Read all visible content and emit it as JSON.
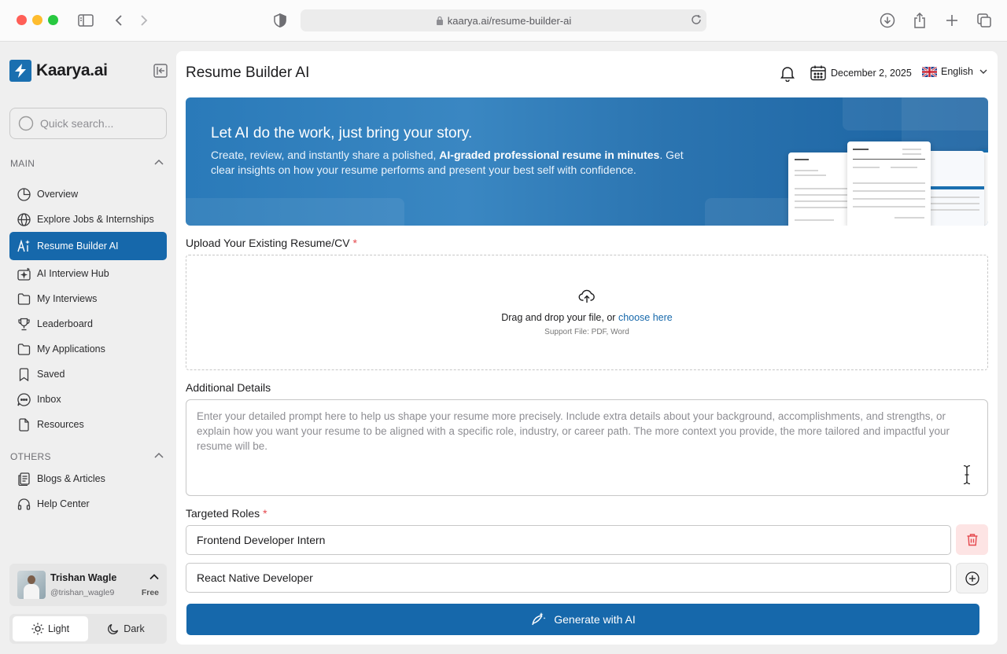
{
  "browser": {
    "url": "kaarya.ai/resume-builder-ai"
  },
  "brand": {
    "name": "Kaarya.ai",
    "accent": "#1668ab"
  },
  "sidebar": {
    "search_placeholder": "Quick search...",
    "main_label": "MAIN",
    "main_items": [
      {
        "label": "Overview",
        "icon": "pie-chart-icon"
      },
      {
        "label": "Explore Jobs & Internships",
        "icon": "globe-icon"
      },
      {
        "label": "Resume Builder AI",
        "icon": "ai-text-icon",
        "active": true
      },
      {
        "label": "AI Interview Hub",
        "icon": "sparkle-camera-icon"
      },
      {
        "label": "My Interviews",
        "icon": "folder-icon"
      },
      {
        "label": "Leaderboard",
        "icon": "trophy-icon"
      },
      {
        "label": "My Applications",
        "icon": "folder-icon"
      },
      {
        "label": "Saved",
        "icon": "bookmark-icon"
      },
      {
        "label": "Inbox",
        "icon": "chat-icon"
      },
      {
        "label": "Resources",
        "icon": "document-icon"
      }
    ],
    "others_label": "OTHERS",
    "others_items": [
      {
        "label": "Blogs & Articles",
        "icon": "articles-icon"
      },
      {
        "label": "Help Center",
        "icon": "headphones-icon"
      }
    ],
    "user": {
      "name": "Trishan Wagle",
      "handle": "@trishan_wagle9",
      "plan": "Free"
    },
    "theme": {
      "light_label": "Light",
      "dark_label": "Dark",
      "selected": "Light"
    }
  },
  "header": {
    "title": "Resume Builder AI",
    "date": "December 2, 2025",
    "language": "English"
  },
  "banner": {
    "title": "Let AI do the work, just bring your story.",
    "text_before": "Create, review, and instantly share a polished, ",
    "text_bold": "AI-graded professional resume in minutes",
    "text_after": ". Get clear insights on how your resume performs and present your best self with confidence."
  },
  "upload": {
    "label": "Upload Your Existing Resume/CV",
    "required_mark": "*",
    "drag_text": "Drag and drop your file, or",
    "choose_link": "choose here",
    "support_text": "Support File: PDF, Word"
  },
  "details": {
    "label": "Additional Details",
    "placeholder": "Enter your detailed prompt here to help us shape your resume more precisely. Include extra details about your background, accomplishments, and strengths, or explain how you want your resume to be aligned with a specific role, industry, or career path. The more context you provide, the more tailored and impactful your resume will be."
  },
  "roles": {
    "label": "Targeted Roles",
    "required_mark": "*",
    "items": [
      "Frontend Developer Intern",
      "React Native Developer"
    ]
  },
  "generate_label": "Generate with AI"
}
